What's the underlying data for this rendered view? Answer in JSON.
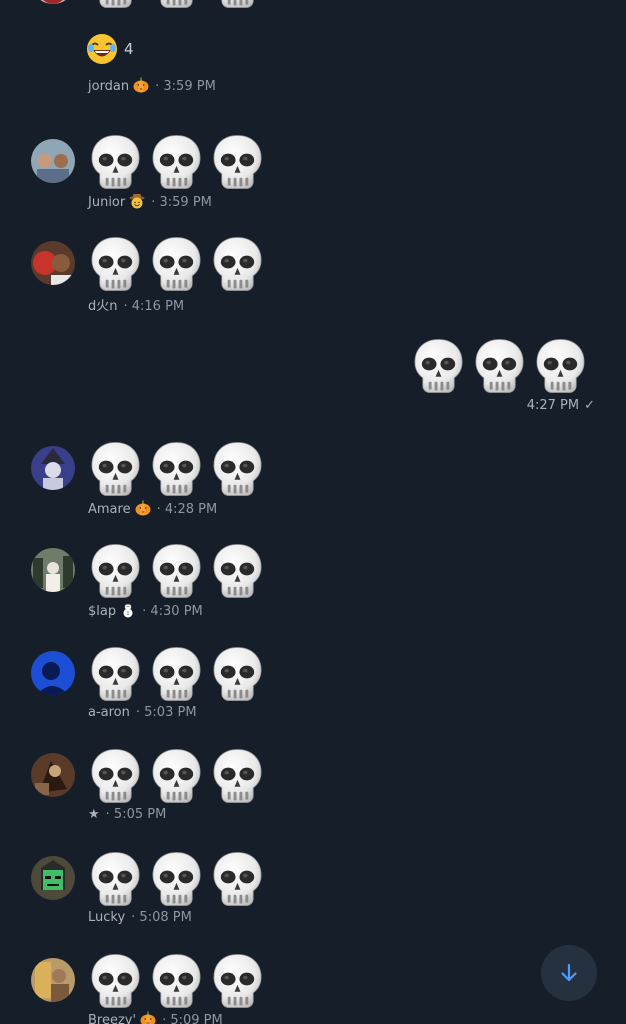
{
  "top_reaction": {
    "emoji": "😂",
    "count": "4"
  },
  "messages": [
    {
      "id": "jordan",
      "author": "jordan",
      "badge": "pumpkin",
      "time": "· 3:59 PM",
      "emoji_count": 3
    },
    {
      "id": "junior",
      "author": "Junior",
      "badge": "cowboy",
      "time": "· 3:59 PM",
      "emoji_count": 3
    },
    {
      "id": "dkn",
      "author": "d火n",
      "badge": "",
      "time": "· 4:16 PM",
      "emoji_count": 3
    },
    {
      "id": "amare",
      "author": "Amare",
      "badge": "pumpkin",
      "time": "· 4:28 PM",
      "emoji_count": 3
    },
    {
      "id": "slap",
      "author": "$lap",
      "badge": "snowman",
      "time": "· 4:30 PM",
      "emoji_count": 3
    },
    {
      "id": "aaron",
      "author": "a-aron",
      "badge": "",
      "time": "· 5:03 PM",
      "emoji_count": 3
    },
    {
      "id": "star",
      "author": "★",
      "badge": "",
      "time": "· 5:05 PM",
      "emoji_count": 3
    },
    {
      "id": "lucky",
      "author": "Lucky",
      "badge": "",
      "time": "· 5:08 PM",
      "emoji_count": 3
    },
    {
      "id": "breezy",
      "author": "Breezy'",
      "badge": "pumpkin",
      "time": "· 5:09 PM",
      "emoji_count": 3
    }
  ],
  "sent": {
    "time": "4:27 PM",
    "status": "✓",
    "emoji_count": 3
  },
  "scroll_button": {
    "icon": "arrow-down-icon",
    "color": "#4d9bff"
  },
  "colors": {
    "background": "#161e29",
    "meta_text": "#aab1bc",
    "accent": "#4d9bff"
  }
}
